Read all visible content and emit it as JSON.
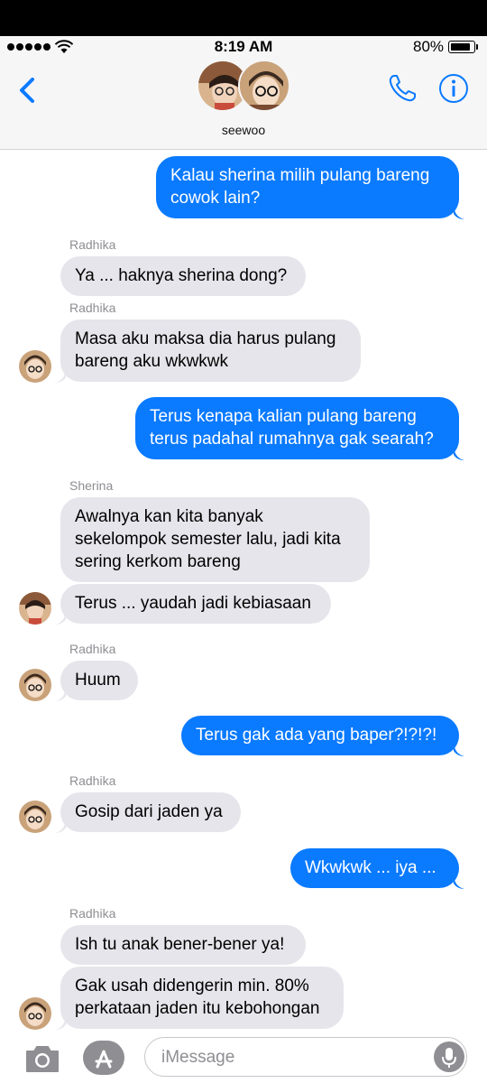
{
  "status": {
    "time": "8:19 AM",
    "battery": "80%"
  },
  "header": {
    "contact_name": "seewoo"
  },
  "messages": [
    {
      "dir": "out",
      "lines": [
        "Kalau sherina milih pulang bareng",
        "cowok lain?"
      ]
    },
    {
      "dir": "in",
      "sender": "Radhika",
      "lines": [
        "Ya ... haknya sherina dong?"
      ]
    },
    {
      "dir": "in",
      "sender": "Radhika",
      "lines": [
        "Masa aku maksa dia harus pulang",
        "bareng aku wkwkwk"
      ]
    },
    {
      "dir": "out",
      "lines": [
        "Terus kenapa kalian pulang bareng",
        "terus padahal rumahnya gak searah?"
      ]
    },
    {
      "dir": "in",
      "sender": "Sherina",
      "lines": [
        "Awalnya kan kita banyak",
        "sekelompok semester lalu, jadi kita",
        "sering kerkom bareng"
      ]
    },
    {
      "dir": "in",
      "lines": [
        "Terus ... yaudah jadi kebiasaan"
      ]
    },
    {
      "dir": "in",
      "sender": "Radhika",
      "lines": [
        "Huum"
      ]
    },
    {
      "dir": "out",
      "lines": [
        "Terus gak ada yang baper?!?!?!"
      ]
    },
    {
      "dir": "in",
      "sender": "Radhika",
      "lines": [
        "Gosip dari jaden ya"
      ]
    },
    {
      "dir": "out",
      "lines": [
        "Wkwkwk ... iya ..."
      ]
    },
    {
      "dir": "in",
      "sender": "Radhika",
      "lines": [
        "Ish tu anak bener-bener ya!"
      ]
    },
    {
      "dir": "in",
      "lines": [
        "Gak usah didengerin min. 80%",
        "perkataan jaden itu kebohongan"
      ]
    }
  ],
  "composer": {
    "placeholder": "iMessage"
  },
  "icons": {
    "back": "chevron-left-icon",
    "phone": "phone-icon",
    "info": "info-icon",
    "camera": "camera-icon",
    "apps": "app-store-icon",
    "mic": "microphone-icon"
  },
  "colors": {
    "accent": "#0a7aff",
    "incoming": "#e6e5eb",
    "meta": "#8e8e93"
  }
}
